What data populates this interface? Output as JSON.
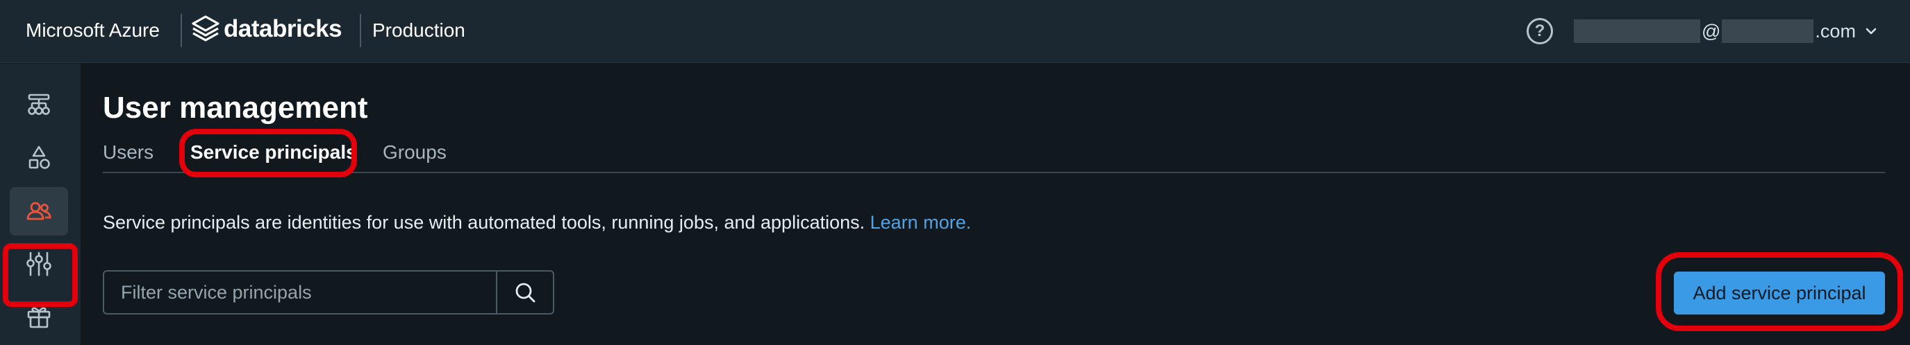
{
  "header": {
    "brand_cloud": "Microsoft Azure",
    "brand_product": "databricks",
    "workspace": "Production",
    "help_label": "?",
    "user": {
      "at_sign": "@",
      "domain_suffix": ".com"
    }
  },
  "sidebar": {
    "items": [
      {
        "icon": "workflow-icon",
        "active": false
      },
      {
        "icon": "shapes-icon",
        "active": false
      },
      {
        "icon": "users-icon",
        "active": true
      },
      {
        "icon": "sliders-icon",
        "active": false
      },
      {
        "icon": "gift-icon",
        "active": false
      }
    ]
  },
  "main": {
    "title": "User management",
    "tabs": [
      {
        "label": "Users",
        "active": false
      },
      {
        "label": "Service principals",
        "active": true
      },
      {
        "label": "Groups",
        "active": false
      }
    ],
    "description": "Service principals are identities for use with automated tools, running jobs, and applications.",
    "learn_more": "Learn more.",
    "filter_placeholder": "Filter service principals",
    "add_button": "Add service principal"
  },
  "colors": {
    "accent": "#3b9ae6",
    "link": "#4fa3e6",
    "highlight": "#e3000b",
    "active_icon": "#e8553b"
  }
}
